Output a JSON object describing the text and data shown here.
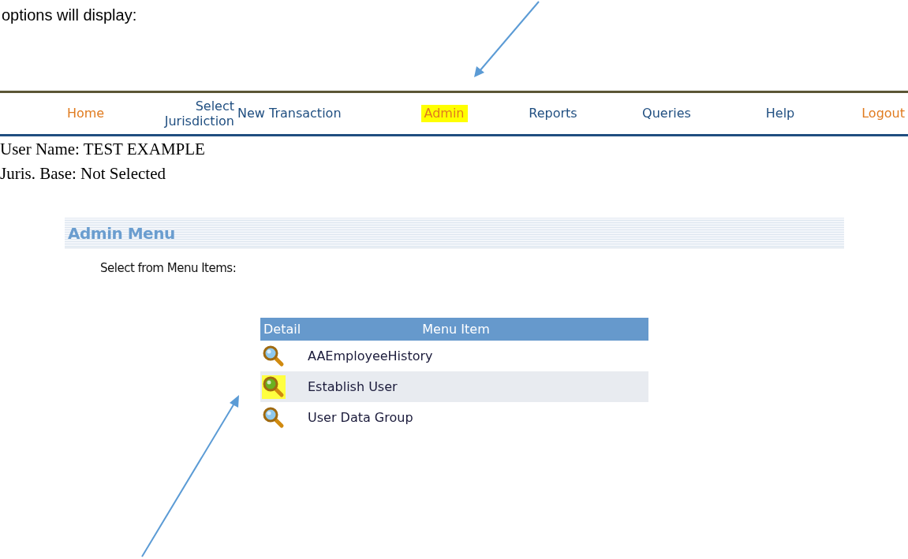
{
  "intro": "options will display:",
  "nav": [
    {
      "label": "Home",
      "kind": "accent",
      "highlighted": false
    },
    {
      "label": "Select Jurisdiction",
      "kind": "plain",
      "highlighted": false
    },
    {
      "label": "New Transaction",
      "kind": "plain",
      "highlighted": false
    },
    {
      "label": "Admin",
      "kind": "accent",
      "highlighted": true
    },
    {
      "label": "Reports",
      "kind": "plain",
      "highlighted": false
    },
    {
      "label": "Queries",
      "kind": "plain",
      "highlighted": false
    },
    {
      "label": "Help",
      "kind": "plain",
      "highlighted": false
    },
    {
      "label": "Logout",
      "kind": "accent",
      "highlighted": false
    }
  ],
  "user_info": [
    "User Name: TEST EXAMPLE",
    "Juris. Base: Not Selected"
  ],
  "panel": {
    "title": "Admin Menu",
    "instruction": "Select from Menu Items:"
  },
  "table": {
    "columns": [
      "Detail",
      "Menu Item"
    ],
    "rows": [
      {
        "item": "AAEmployeeHistory",
        "highlighted": false
      },
      {
        "item": "Establish User",
        "highlighted": true
      },
      {
        "item": "User Data Group",
        "highlighted": false
      }
    ]
  }
}
